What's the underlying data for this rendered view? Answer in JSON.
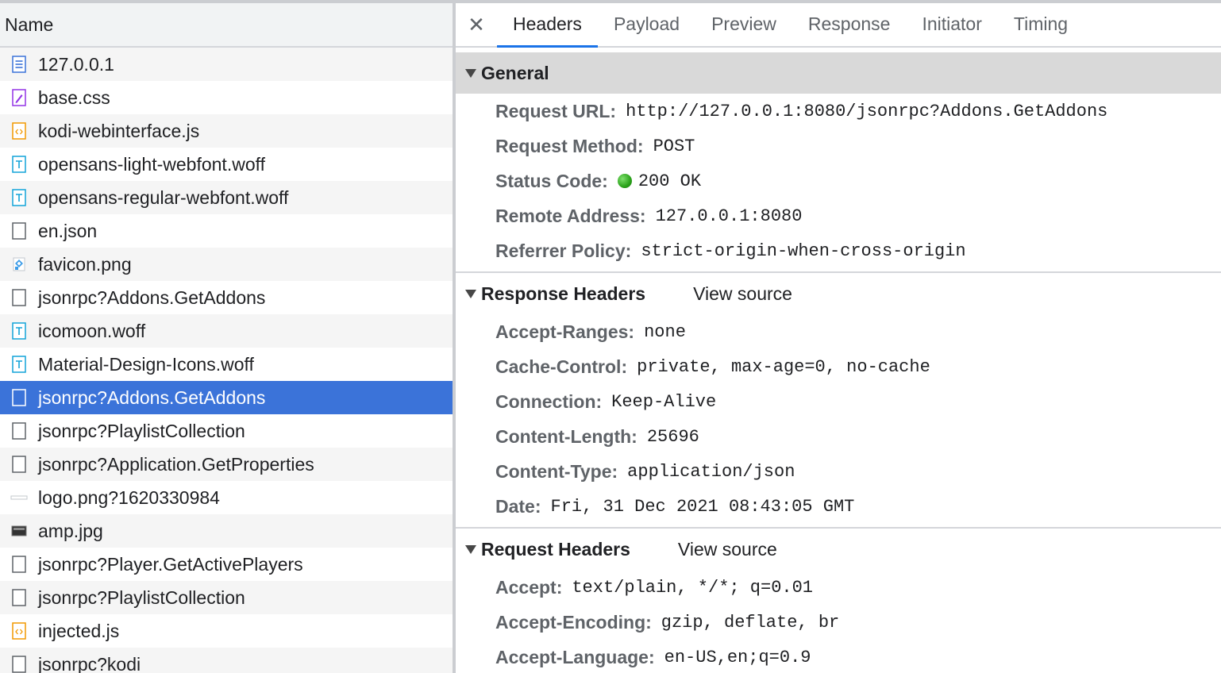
{
  "request_list": {
    "header": "Name",
    "items": [
      {
        "name": "127.0.0.1",
        "icon": "document-icon",
        "selected": false
      },
      {
        "name": "base.css",
        "icon": "stylesheet-icon",
        "selected": false
      },
      {
        "name": "kodi-webinterface.js",
        "icon": "script-icon",
        "selected": false
      },
      {
        "name": "opensans-light-webfont.woff",
        "icon": "font-icon",
        "selected": false
      },
      {
        "name": "opensans-regular-webfont.woff",
        "icon": "font-icon",
        "selected": false
      },
      {
        "name": "en.json",
        "icon": "blank-file-icon",
        "selected": false
      },
      {
        "name": "favicon.png",
        "icon": "image-icon",
        "selected": false
      },
      {
        "name": "jsonrpc?Addons.GetAddons",
        "icon": "blank-file-icon",
        "selected": false
      },
      {
        "name": "icomoon.woff",
        "icon": "font-icon",
        "selected": false
      },
      {
        "name": "Material-Design-Icons.woff",
        "icon": "font-icon",
        "selected": false
      },
      {
        "name": "jsonrpc?Addons.GetAddons",
        "icon": "blank-file-icon",
        "selected": true
      },
      {
        "name": "jsonrpc?PlaylistCollection",
        "icon": "blank-file-icon",
        "selected": false
      },
      {
        "name": "jsonrpc?Application.GetProperties",
        "icon": "blank-file-icon",
        "selected": false
      },
      {
        "name": "logo.png?1620330984",
        "icon": "thin-image-icon",
        "selected": false
      },
      {
        "name": "amp.jpg",
        "icon": "photo-icon",
        "selected": false
      },
      {
        "name": "jsonrpc?Player.GetActivePlayers",
        "icon": "blank-file-icon",
        "selected": false
      },
      {
        "name": "jsonrpc?PlaylistCollection",
        "icon": "blank-file-icon",
        "selected": false
      },
      {
        "name": "injected.js",
        "icon": "script-icon",
        "selected": false
      },
      {
        "name": "jsonrpc?kodi",
        "icon": "blank-file-icon",
        "selected": false
      }
    ]
  },
  "tabs": {
    "close_icon": "close-icon",
    "items": [
      "Headers",
      "Payload",
      "Preview",
      "Response",
      "Initiator",
      "Timing"
    ],
    "active": "Headers"
  },
  "general": {
    "title": "General",
    "rows": [
      {
        "key": "Request URL:",
        "value": "http://127.0.0.1:8080/jsonrpc?Addons.GetAddons"
      },
      {
        "key": "Request Method:",
        "value": "POST"
      },
      {
        "key": "Status Code:",
        "value": "200 OK",
        "status_dot_color": "#2aa21a"
      },
      {
        "key": "Remote Address:",
        "value": "127.0.0.1:8080"
      },
      {
        "key": "Referrer Policy:",
        "value": "strict-origin-when-cross-origin"
      }
    ]
  },
  "response_headers": {
    "title": "Response Headers",
    "view_source": "View source",
    "rows": [
      {
        "key": "Accept-Ranges:",
        "value": "none"
      },
      {
        "key": "Cache-Control:",
        "value": "private, max-age=0, no-cache"
      },
      {
        "key": "Connection:",
        "value": "Keep-Alive"
      },
      {
        "key": "Content-Length:",
        "value": "25696"
      },
      {
        "key": "Content-Type:",
        "value": "application/json"
      },
      {
        "key": "Date:",
        "value": "Fri, 31 Dec 2021 08:43:05 GMT"
      }
    ]
  },
  "request_headers": {
    "title": "Request Headers",
    "view_source": "View source",
    "rows": [
      {
        "key": "Accept:",
        "value": "text/plain, */*; q=0.01"
      },
      {
        "key": "Accept-Encoding:",
        "value": "gzip, deflate, br"
      },
      {
        "key": "Accept-Language:",
        "value": "en-US,en;q=0.9"
      }
    ]
  },
  "colors": {
    "selected_row": "#3b73d9",
    "active_tab_underline": "#1a73e8",
    "status_ok": "#2aa21a"
  }
}
